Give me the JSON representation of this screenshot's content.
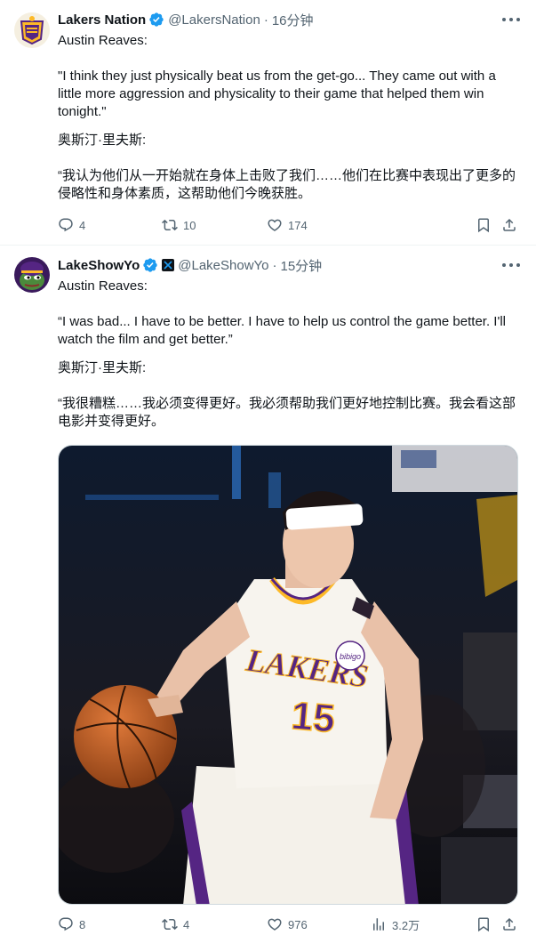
{
  "tweets": [
    {
      "display_name": "Lakers Nation",
      "handle": "@LakersNation",
      "time": "16分钟",
      "paragraphs": [
        "Austin Reaves:",
        "\"I think they just physically beat us from the get-go... They came out with a little more aggression and physicality to their game that helped them win tonight.\"",
        "奥斯汀·里夫斯:",
        "“我认为他们从一开始就在身体上击败了我们……他们在比赛中表现出了更多的侵略性和身体素质，这帮助他们今晚获胜。"
      ],
      "reply_count": "4",
      "retweet_count": "10",
      "like_count": "174"
    },
    {
      "display_name": "LakeShowYo",
      "handle": "@LakeShowYo",
      "time": "15分钟",
      "paragraphs": [
        "Austin Reaves:",
        "“I was bad... I have to be better. I have to help us control the game better. I'll watch the film and get better.”",
        "奥斯汀·里夫斯:",
        "“我很糟糕……我必须变得更好。我必须帮助我们更好地控制比赛。我会看这部电影并变得更好。"
      ],
      "jersey_brand": "LAKERS",
      "jersey_number": "15",
      "jersey_patch": "bibigo",
      "reply_count": "8",
      "retweet_count": "4",
      "like_count": "976",
      "view_count": "3.2万"
    }
  ],
  "colors": {
    "text_primary": "#0f1419",
    "text_secondary": "#536471",
    "verified_blue": "#1d9bf0",
    "lakers_purple": "#552583",
    "lakers_gold": "#fdb927",
    "divider": "#eff3f4"
  },
  "icons": [
    "verified-badge-icon",
    "more-icon",
    "reply-icon",
    "retweet-icon",
    "like-icon",
    "views-icon",
    "bookmark-icon",
    "share-icon",
    "affiliate-x-icon"
  ]
}
